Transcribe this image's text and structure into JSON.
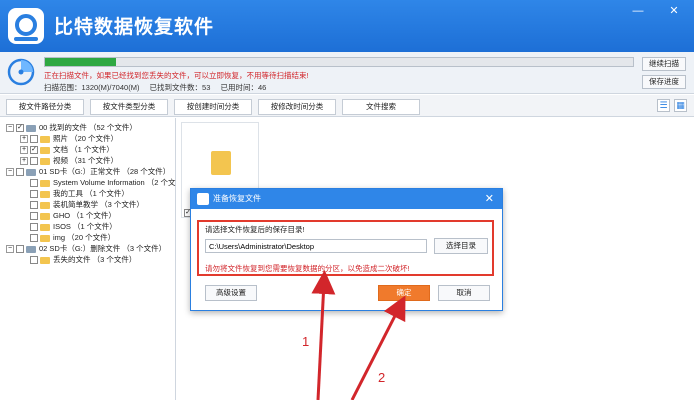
{
  "app": {
    "title": "比特数据恢复软件"
  },
  "window_controls": {
    "minimize": "—",
    "close": "✕"
  },
  "scan": {
    "progress": 0.12,
    "message": "正在扫描文件，如果已经找到您丢失的文件，可以立即恢复，不用等待扫描结束!",
    "range_label": "扫描范围：1320(M)/7040(M)",
    "found_label": "已找到文件数：53",
    "elapsed_label": "已用时间：46",
    "continue_button": "继续扫描",
    "save_progress_button": "保存进度"
  },
  "tabs": [
    {
      "label": "按文件路径分类"
    },
    {
      "label": "按文件类型分类"
    },
    {
      "label": "按创建时间分类"
    },
    {
      "label": "按修改时间分类"
    },
    {
      "label": "文件搜索"
    }
  ],
  "tree": [
    {
      "label": "00 找到的文件 （52 个文件）"
    },
    {
      "label": "照片 （20 个文件）"
    },
    {
      "label": "文档 （1 个文件）"
    },
    {
      "label": "视频 （31 个文件）"
    },
    {
      "label": "01 SD卡（G:）正常文件 （28 个文件）"
    },
    {
      "label": "System Volume Information （2 个文"
    },
    {
      "label": "我的工具 （1 个文件）"
    },
    {
      "label": "装机简单教学 （3 个文件）"
    },
    {
      "label": "GHO （1 个文件）"
    },
    {
      "label": "ISOS （1 个文件）"
    },
    {
      "label": "img （20 个文件）"
    },
    {
      "label": "02 SD卡（G:）删除文件 （3 个文件）"
    },
    {
      "label": "丢失的文件 （3 个文件）"
    }
  ],
  "dialog": {
    "title": "准备恢复文件",
    "close": "✕",
    "prompt": "请选择文件恢复后的保存目录!",
    "path_value": "C:\\Users\\Administrator\\Desktop",
    "browse_button": "选择目录",
    "warning": "请勿将文件恢复到您需要恢复数据的分区，以免造成二次破坏!",
    "advanced_button": "高级设置",
    "ok_button": "确定",
    "cancel_button": "取消"
  },
  "annotations": {
    "arrow1_label": "1",
    "arrow2_label": "2",
    "color": "#d2262b"
  }
}
